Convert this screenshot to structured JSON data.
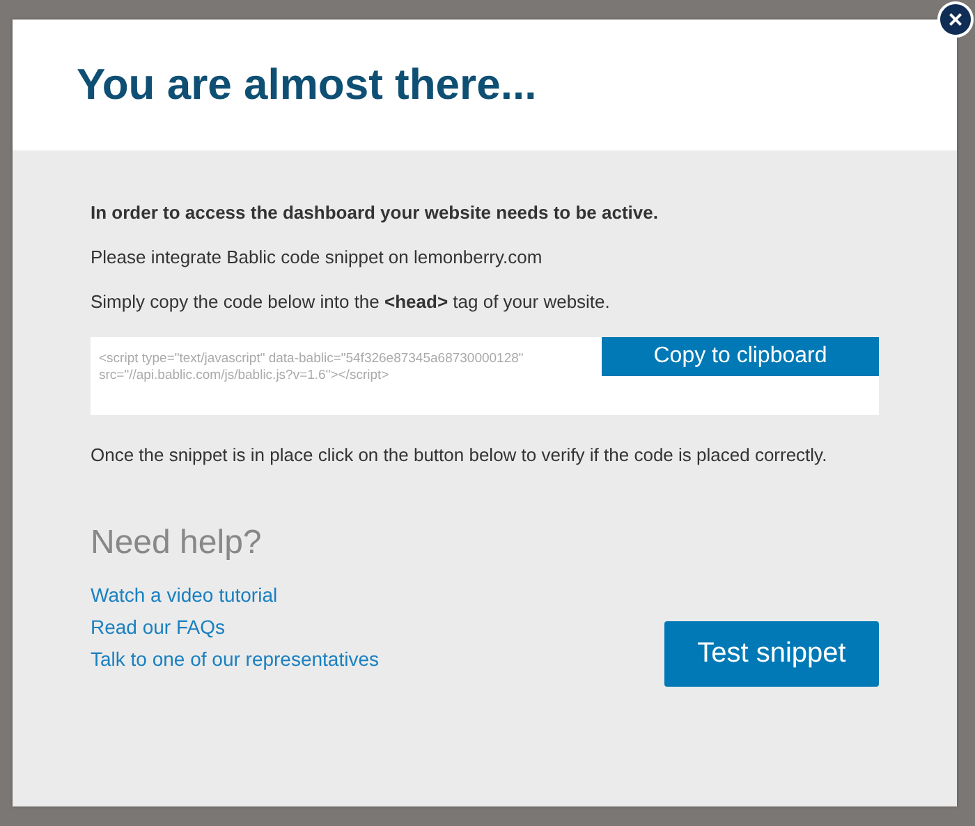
{
  "dialog": {
    "title": "You are almost there...",
    "close_label": "×"
  },
  "body": {
    "notice": "In order to access the dashboard your website needs to be active.",
    "integrate": "Please integrate Bablic code snippet on lemonberry.com",
    "instruction": "Simply copy the code below into the **<head>** tag of your website.",
    "snippet": "<script type=\"text/javascript\" data-bablic=\"54f326e87345a68730000128\" src=\"//api.bablic.com/js/bablic.js?v=1.6\"></script>",
    "copy_button": "Copy to clipboard",
    "verify": "Once the snippet is in place click on the button below to verify if the code is placed correctly."
  },
  "help": {
    "heading": "Need help?",
    "links": [
      "Watch a video tutorial",
      "Read our FAQs",
      "Talk to one of our representatives"
    ]
  },
  "test_button": "Test snippet"
}
